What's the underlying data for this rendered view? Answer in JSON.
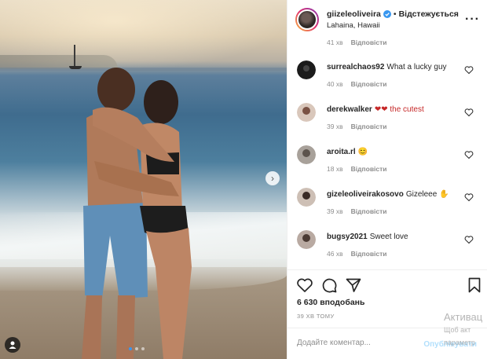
{
  "post": {
    "username": "giizeleoliveira",
    "separator": "•",
    "follow_state": "Відстежується",
    "location": "Lahaina, Hawaii",
    "more_icon": "more-options-icon"
  },
  "comments_top_meta": {
    "time": "41 хв",
    "reply_label": "Відповісти"
  },
  "comments": [
    {
      "username": "surrealchaos92",
      "text": "What a lucky guy",
      "time": "40 хв",
      "reply_label": "Відповісти"
    },
    {
      "username": "derekwalker",
      "text": "❤❤ the cutest",
      "time": "39 хв",
      "reply_label": "Відповісти"
    },
    {
      "username": "aroita.rl",
      "text": "😊",
      "time": "18 хв",
      "reply_label": "Відповісти"
    },
    {
      "username": "gizeleoliveirakosovo",
      "text": "Gizeleee ✋",
      "time": "39 хв",
      "reply_label": "Відповісти"
    },
    {
      "username": "bugsy2021",
      "text": "Sweet love",
      "time": "46 хв",
      "reply_label": "Відповісти"
    }
  ],
  "likes_text": "6 630 вподобань",
  "time_ago": "39 ХВ ТОМУ",
  "add_comment": {
    "placeholder": "Додайте коментар...",
    "publish_label": "Опублікувати"
  },
  "watermark": {
    "line1": "Активац",
    "line2": "Щоб акт",
    "line3": "параметр"
  },
  "carousel": {
    "total": 3,
    "active": 1
  },
  "colors": {
    "accent": "#3897f0",
    "like_red": "#c62828",
    "muted": "#8e8e8e"
  }
}
